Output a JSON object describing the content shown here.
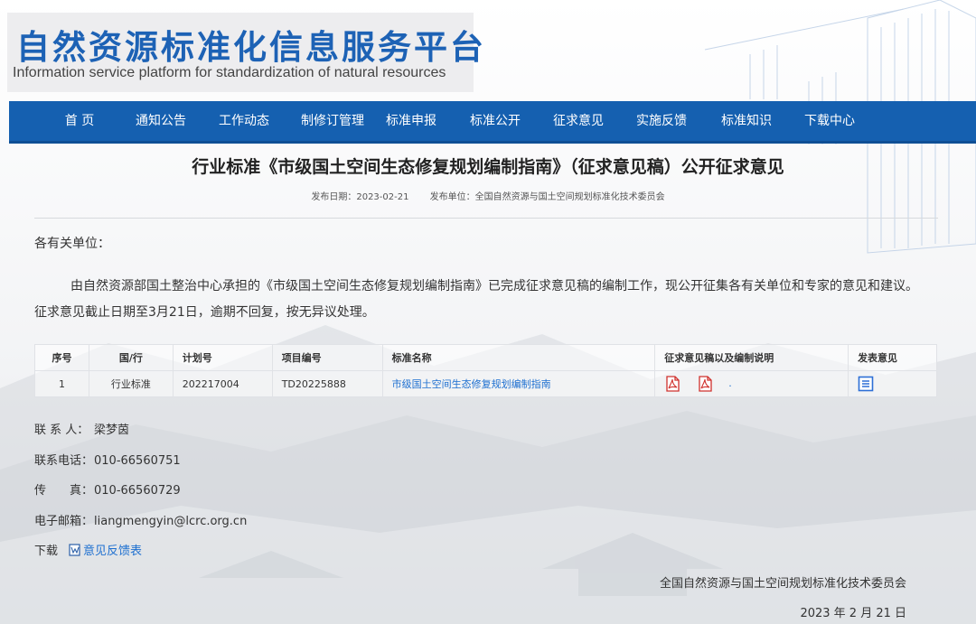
{
  "site": {
    "title_cn": "自然资源标准化信息服务平台",
    "title_en": "Information service platform for standardization of natural resources"
  },
  "nav": {
    "items": [
      "首 页",
      "通知公告",
      "工作动态",
      "制修订管理",
      "标准申报",
      "标准公开",
      "征求意见",
      "实施反馈",
      "标准知识",
      "下载中心"
    ]
  },
  "article": {
    "title": "行业标准《市级国土空间生态修复规划编制指南》（征求意见稿）公开征求意见",
    "publish_date": "发布日期：2023-02-21",
    "publisher": "发布单位：全国自然资源与国土空间规划标准化技术委员会",
    "salutation": "各有关单位：",
    "body": "由自然资源部国土整治中心承担的《市级国土空间生态修复规划编制指南》已完成征求意见稿的编制工作，现公开征集各有关单位和专家的意见和建议。征求意见截止日期至3月21日，逾期不回复，按无异议处理。"
  },
  "table": {
    "headers": [
      "序号",
      "国/行",
      "计划号",
      "项目编号",
      "标准名称",
      "征求意见稿以及编制说明",
      "发表意见"
    ],
    "row": {
      "no": "1",
      "level": "行业标准",
      "plan_no": "202217004",
      "project_no": "TD20225888",
      "name": "市级国土空间生态修复规划编制指南",
      "trailing": "."
    }
  },
  "contact": {
    "person_label": "联 系 人：",
    "person": "梁梦茵",
    "phone_label": "联系电话：",
    "phone": "010-66560751",
    "fax_label": "传　　真：",
    "fax": "010-66560729",
    "email_label": "电子邮箱：",
    "email": "liangmengyin@lcrc.org.cn",
    "download_label": "下载",
    "download_link": "意见反馈表"
  },
  "signature": {
    "org": "全国自然资源与国土空间规划标准化技术委员会",
    "date": "2023 年 2 月 21 日"
  },
  "colors": {
    "brand_blue": "#1d62b5",
    "nav_blue": "#1560b0",
    "link_blue": "#1d6fd0",
    "pdf_red": "#d0312d"
  }
}
